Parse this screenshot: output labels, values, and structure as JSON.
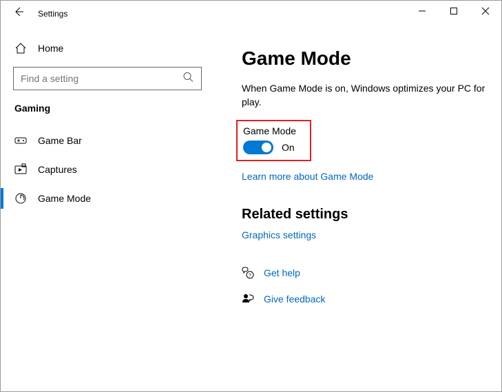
{
  "titlebar": {
    "app_title": "Settings"
  },
  "sidebar": {
    "home_label": "Home",
    "search_placeholder": "Find a setting",
    "category": "Gaming",
    "items": [
      {
        "label": "Game Bar"
      },
      {
        "label": "Captures"
      },
      {
        "label": "Game Mode"
      }
    ]
  },
  "main": {
    "title": "Game Mode",
    "description": "When Game Mode is on, Windows optimizes your PC for play.",
    "toggle_label": "Game Mode",
    "toggle_state": "On",
    "learn_link": "Learn more about Game Mode",
    "related_header": "Related settings",
    "graphics_link": "Graphics settings",
    "help_link": "Get help",
    "feedback_link": "Give feedback"
  }
}
